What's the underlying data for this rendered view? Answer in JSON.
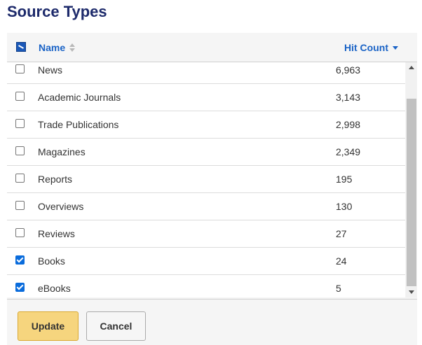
{
  "title": "Source Types",
  "header": {
    "name_label": "Name",
    "hits_label": "Hit Count"
  },
  "items": [
    {
      "label": "News",
      "count": "6,963",
      "checked": false
    },
    {
      "label": "Academic Journals",
      "count": "3,143",
      "checked": false
    },
    {
      "label": "Trade Publications",
      "count": "2,998",
      "checked": false
    },
    {
      "label": "Magazines",
      "count": "2,349",
      "checked": false
    },
    {
      "label": "Reports",
      "count": "195",
      "checked": false
    },
    {
      "label": "Overviews",
      "count": "130",
      "checked": false
    },
    {
      "label": "Reviews",
      "count": "27",
      "checked": false
    },
    {
      "label": "Books",
      "count": "24",
      "checked": true
    },
    {
      "label": "eBooks",
      "count": "5",
      "checked": true
    }
  ],
  "buttons": {
    "update_label": "Update",
    "cancel_label": "Cancel"
  },
  "colors": {
    "title": "#1d2a6b",
    "link": "#1a63c6",
    "checkbox_checked": "#0a6cdc",
    "update_button": "#f6d57e"
  }
}
